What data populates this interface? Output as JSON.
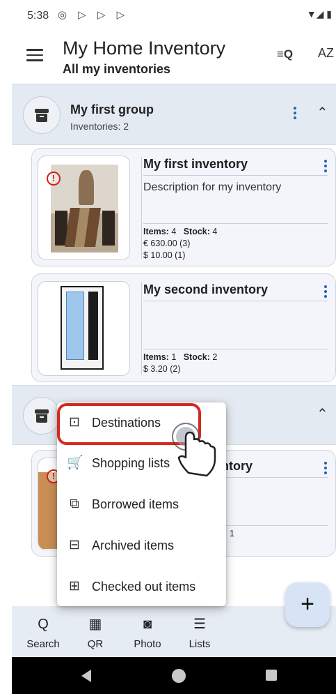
{
  "status_bar": {
    "time": "5:38",
    "notification_icons": "◎ ▷ ▷ ▷",
    "system_icons": "▼◢ ▮"
  },
  "app_bar": {
    "title": "My Home Inventory",
    "subtitle": "All my inventories",
    "filter_icon": "≡Q",
    "sort_icon": "AZ"
  },
  "groups": [
    {
      "name": "My first group",
      "count_label": "Inventories: 2",
      "inventories": [
        {
          "name": "My first inventory",
          "description": "Description for my inventory",
          "items_label": "Items:",
          "items": "4",
          "stock_label": "Stock:",
          "stock": "4",
          "values": [
            "€ 630.00 (3)",
            "$ 10.00 (1)"
          ],
          "alert": true
        },
        {
          "name": "My second inventory",
          "description": "",
          "items_label": "Items:",
          "items": "1",
          "stock_label": "Stock:",
          "stock": "2",
          "values": [
            "$ 3.20 (2)"
          ],
          "alert": false
        }
      ]
    },
    {
      "name": "",
      "count_label": "",
      "inventories": [
        {
          "name_partial": "ntory",
          "stats_partial": "1",
          "alert": true
        }
      ]
    }
  ],
  "popup_menu": {
    "items": [
      {
        "label": "Destinations",
        "icon": "destinations-icon",
        "glyph": "⊡",
        "highlighted": true
      },
      {
        "label": "Shopping lists",
        "icon": "cart-icon",
        "glyph": "🛒"
      },
      {
        "label": "Borrowed items",
        "icon": "borrowed-icon",
        "glyph": "⧉"
      },
      {
        "label": "Archived items",
        "icon": "archive-icon",
        "glyph": "⊟"
      },
      {
        "label": "Checked out items",
        "icon": "checkout-icon",
        "glyph": "⊞"
      }
    ]
  },
  "fab": {
    "label": "+"
  },
  "bottom_nav": [
    {
      "label": "Search",
      "icon": "search-icon",
      "glyph": "Q"
    },
    {
      "label": "QR",
      "icon": "qr-icon",
      "glyph": "▦"
    },
    {
      "label": "Photo",
      "icon": "camera-icon",
      "glyph": "◙"
    },
    {
      "label": "Lists",
      "icon": "list-icon",
      "glyph": "☰"
    }
  ],
  "colors": {
    "accent": "#1e63b8",
    "highlight": "#d42a20",
    "group_bg": "#e4eaf1",
    "card_bg": "#f3f5fa",
    "fab_bg": "#d6e4f6"
  }
}
